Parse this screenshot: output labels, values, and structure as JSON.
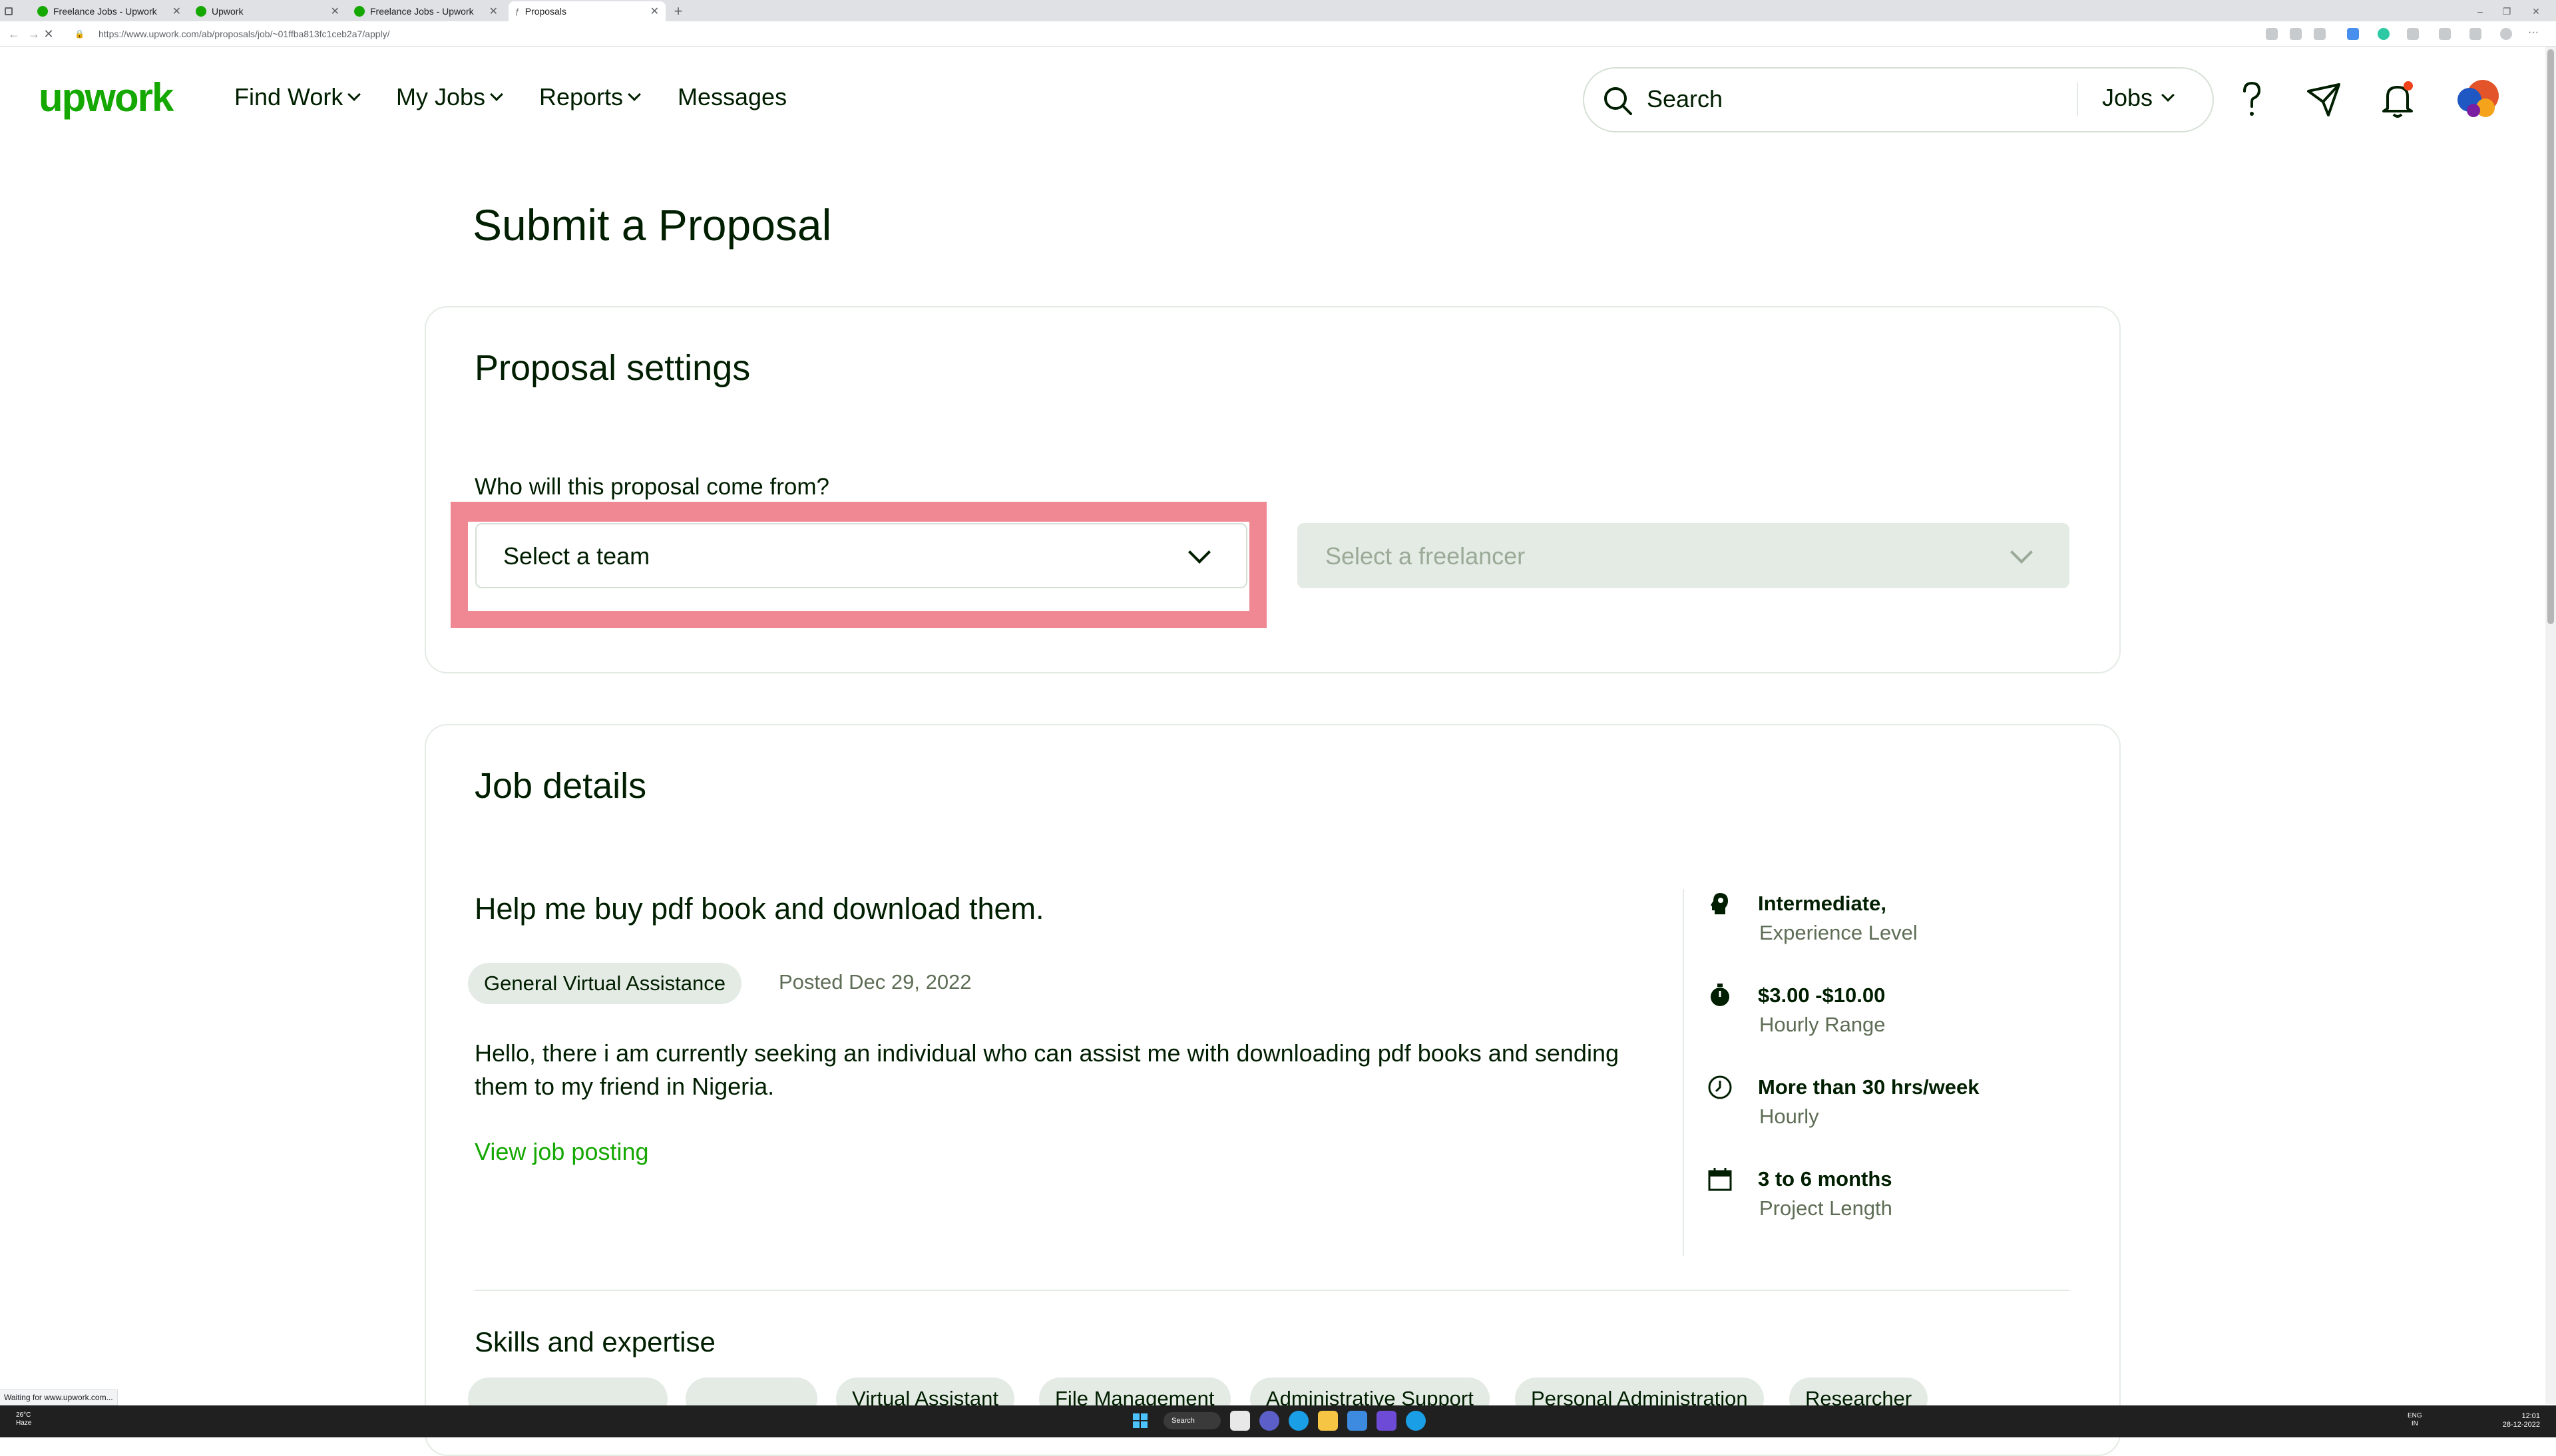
{
  "browser": {
    "tabs": [
      {
        "label": "Freelance Jobs - Upwork"
      },
      {
        "label": "Upwork"
      },
      {
        "label": "Freelance Jobs - Upwork"
      },
      {
        "label": "Proposals"
      }
    ],
    "url": "https://www.upwork.com/ab/proposals/job/~01ffba813fc1ceb2a7/apply/",
    "status_text": "Waiting for www.upwork.com..."
  },
  "header": {
    "logo": "upwork",
    "nav": [
      {
        "label": "Find Work"
      },
      {
        "label": "My Jobs"
      },
      {
        "label": "Reports"
      },
      {
        "label": "Messages"
      }
    ],
    "search_placeholder": "Search",
    "search_scope": "Jobs"
  },
  "page": {
    "title": "Submit a Proposal",
    "proposal_settings": {
      "heading": "Proposal settings",
      "question": "Who will this proposal come from?",
      "team_select": "Select a team",
      "freelancer_select": "Select a freelancer"
    },
    "job_details": {
      "heading": "Job details",
      "job_title": "Help me buy pdf book and download them.",
      "category": "General Virtual Assistance",
      "posted": "Posted Dec 29, 2022",
      "description": "Hello, there i am currently seeking an individual who can assist me with downloading pdf books and sending them to my friend in Nigeria.",
      "view_posting": "View job posting",
      "meta": [
        {
          "icon": "experience-level-icon",
          "main": "Intermediate,",
          "sub": "Experience Level"
        },
        {
          "icon": "hourly-range-icon",
          "main": "$3.00 -$10.00",
          "sub": "Hourly Range"
        },
        {
          "icon": "clock-icon",
          "main": "More than 30 hrs/week",
          "sub": "Hourly"
        },
        {
          "icon": "calendar-icon",
          "main": "3 to 6 months",
          "sub": "Project Length"
        }
      ]
    },
    "skills": {
      "heading": "Skills and expertise",
      "items": [
        "",
        "",
        "Virtual Assistant",
        "File Management",
        "Administrative Support",
        "Personal Administration",
        "Researcher"
      ]
    }
  },
  "taskbar": {
    "weather_temp": "26°C",
    "weather_text": "Haze",
    "search_label": "Search",
    "lang": "ENG",
    "region": "IN",
    "time": "12:01",
    "date": "28-12-2022"
  },
  "colors": {
    "brand": "#14a800",
    "highlight": "#f08894",
    "tag_bg": "#e4ebe4"
  }
}
